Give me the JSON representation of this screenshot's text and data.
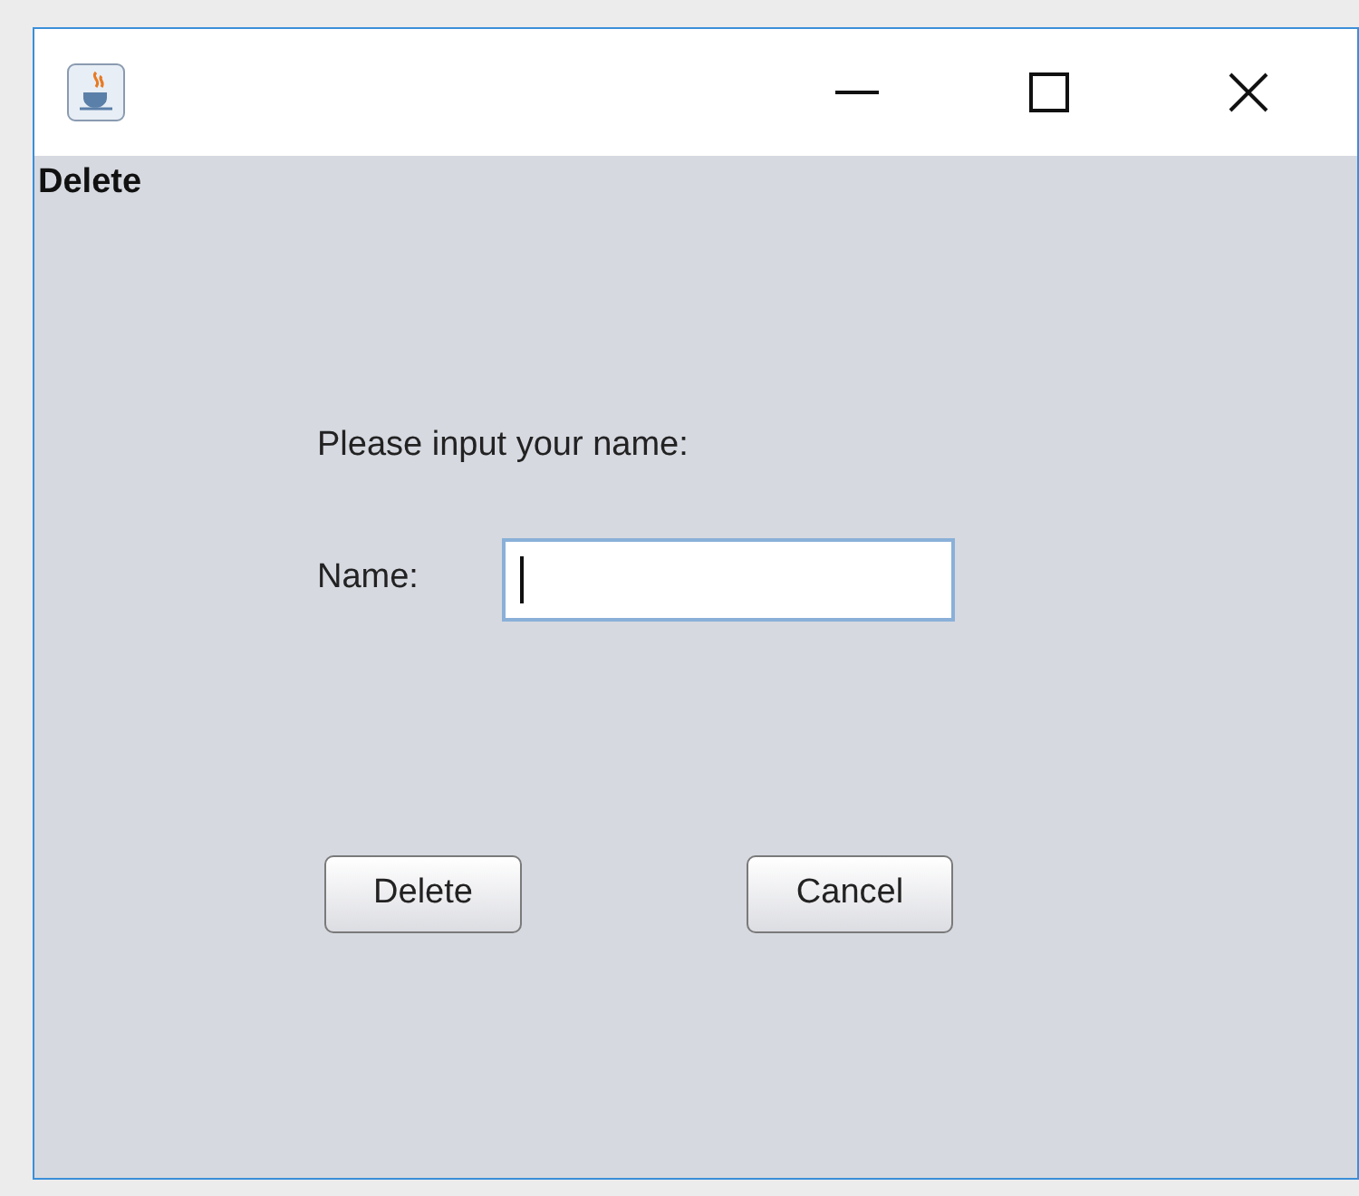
{
  "window": {
    "title_label": "Delete"
  },
  "prompt": "Please input your name:",
  "name_field": {
    "label": "Name:",
    "focused": true
  },
  "buttons": [
    {
      "label": "Delete"
    },
    {
      "label": "Cancel"
    }
  ]
}
